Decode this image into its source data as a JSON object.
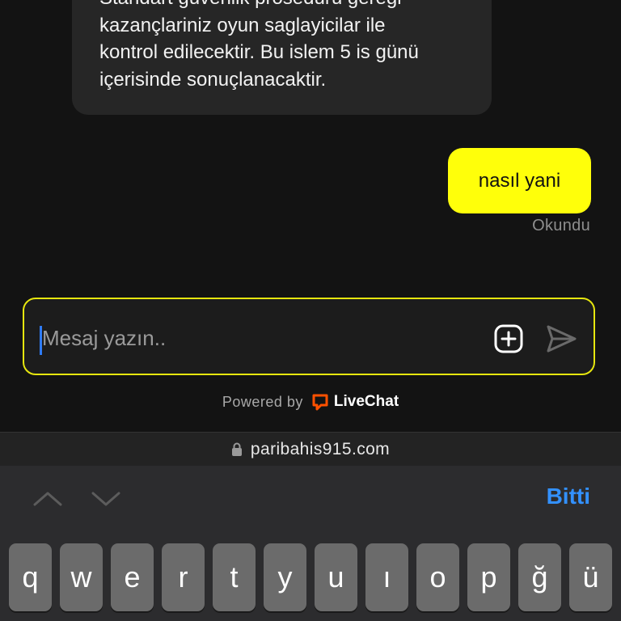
{
  "chat": {
    "agent_message": "Standart güvenlik prosedürü gereği\nkazançlariniz oyun saglayicilar ile\nkontrol edilecektir. Bu islem 5 is günü\niçerisinde sonuçlanacaktir.",
    "user_message": "nasıl yani",
    "read_status": "Okundu"
  },
  "composer": {
    "placeholder": "Mesaj yazın..",
    "value": ""
  },
  "footer": {
    "powered_by": "Powered by",
    "brand": "LiveChat",
    "brand_color": "#ff5100"
  },
  "browser": {
    "url": "paribahis915.com"
  },
  "keyboard_toolbar": {
    "done_label": "Bitti"
  },
  "keyboard": {
    "keys": [
      "q",
      "w",
      "e",
      "r",
      "t",
      "y",
      "u",
      "ı",
      "o",
      "p",
      "ğ",
      "ü"
    ]
  },
  "colors": {
    "accent_yellow": "#ffff0a",
    "done_blue": "#3391ff"
  }
}
